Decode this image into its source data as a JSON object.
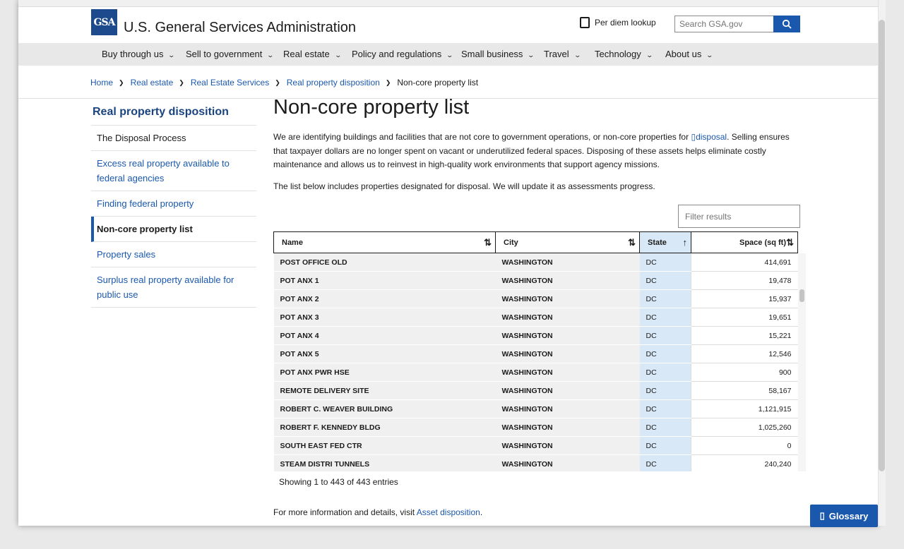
{
  "header": {
    "logo_text": "GSA",
    "agency_name": "U.S. General Services Administration",
    "per_diem_label": "Per diem lookup",
    "search_placeholder": "Search GSA.gov"
  },
  "nav": {
    "items": [
      {
        "label": "Buy through us"
      },
      {
        "label": "Sell to government"
      },
      {
        "label": "Real estate"
      },
      {
        "label": "Policy and regulations"
      },
      {
        "label": "Small business"
      },
      {
        "label": "Travel"
      },
      {
        "label": "Technology"
      },
      {
        "label": "About us"
      }
    ]
  },
  "breadcrumb": [
    "Home",
    "Real estate",
    "Real Estate Services",
    "Real property disposition",
    "Non-core property list"
  ],
  "sidebar": {
    "title": "Real property disposition",
    "items": [
      {
        "label": "The Disposal Process"
      },
      {
        "label": "Excess real property available to federal agencies"
      },
      {
        "label": "Finding federal property"
      },
      {
        "label": "Non-core property list"
      },
      {
        "label": "Property sales"
      },
      {
        "label": "Surplus real property available for public use"
      }
    ]
  },
  "main": {
    "title": "Non-core property list",
    "intro_before": "We are identifying buildings and facilities that are not core to government operations, or non-core properties for ",
    "intro_glossary": "disposal",
    "intro_after": ". Selling ensures that taxpayer dollars are no longer spent on vacant or underutilized federal spaces. Disposing of these assets helps eliminate costly maintenance and allows us to reinvest in high-quality work environments that support agency missions.",
    "note": "The list below includes properties designated for disposal. We will update it as assessments progress.",
    "filter_placeholder": "Filter results",
    "table": {
      "headers": [
        "Name",
        "City",
        "State",
        "Space (sq ft)"
      ],
      "rows": [
        [
          "Post Office Old",
          "Washington",
          "DC",
          "414,691"
        ],
        [
          "Pot Anx 1",
          "Washington",
          "DC",
          "19,478"
        ],
        [
          "Pot Anx 2",
          "Washington",
          "DC",
          "15,937"
        ],
        [
          "Pot Anx 3",
          "Washington",
          "DC",
          "19,651"
        ],
        [
          "Pot Anx 4",
          "Washington",
          "DC",
          "15,221"
        ],
        [
          "Pot Anx 5",
          "Washington",
          "DC",
          "12,546"
        ],
        [
          "Pot Anx Pwr Hse",
          "Washington",
          "DC",
          "900"
        ],
        [
          "Remote Delivery Site",
          "Washington",
          "DC",
          "58,167"
        ],
        [
          "Robert C. Weaver Building",
          "Washington",
          "DC",
          "1,121,915"
        ],
        [
          "Robert F. Kennedy Bldg",
          "Washington",
          "DC",
          "1,025,260"
        ],
        [
          "South East Fed Ctr",
          "Washington",
          "DC",
          "0"
        ],
        [
          "Steam Distri Tunnels",
          "Washington",
          "DC",
          "240,240"
        ]
      ]
    },
    "entries_info": "Showing 1 to 443 of 443 entries",
    "more_before": "For more information and details, visit ",
    "more_link": "Asset disposition",
    "more_after": "."
  },
  "glossary_button": "Glossary",
  "colors": {
    "brand": "#1a58ad",
    "nav_bg": "#e8e8e8",
    "sorted_col": "#d9e8f6"
  }
}
